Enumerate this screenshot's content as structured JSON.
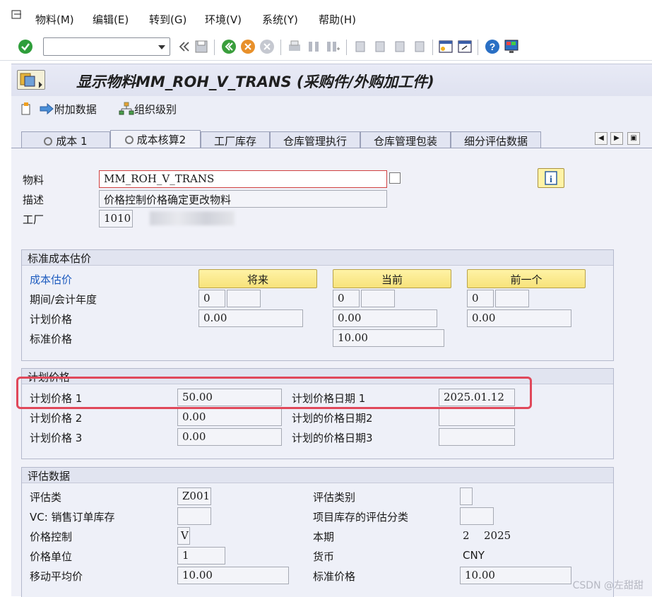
{
  "menu": {
    "items": [
      "物料(M)",
      "编辑(E)",
      "转到(G)",
      "环境(V)",
      "系统(Y)",
      "帮助(H)"
    ]
  },
  "toolbar": {
    "command_value": "",
    "icons": [
      "enter-icon",
      "back-arrows-icon",
      "save-icon",
      "back-icon",
      "exit-icon",
      "cancel-icon",
      "print-icon",
      "find-icon",
      "find-next-icon",
      "first-page-icon",
      "prev-page-icon",
      "next-page-icon",
      "last-page-icon",
      "new-session-icon",
      "shortcut-icon",
      "help-icon",
      "customize-layout-icon"
    ]
  },
  "title": "显示物料MM_ROH_V_TRANS (采购件/外购加工件)",
  "app_toolbar": {
    "additional_data": "附加数据",
    "org_levels": "组织级别"
  },
  "tabs": [
    "成本 1",
    "成本核算2",
    "工厂库存",
    "仓库管理执行",
    "仓库管理包装",
    "细分评估数据"
  ],
  "active_tab": 1,
  "header": {
    "material_label": "物料",
    "material_value": "MM_ROH_V_TRANS",
    "description_label": "描述",
    "description_value": "价格控制价格确定更改物料",
    "plant_label": "工厂",
    "plant_value": "1010"
  },
  "std_cost": {
    "title": "标准成本估价",
    "cost_estimate_label": "成本估价",
    "future_btn": "将来",
    "current_btn": "当前",
    "previous_btn": "前一个",
    "period_label": "期间/会计年度",
    "future_period": "0",
    "current_period": "0",
    "previous_period": "0",
    "planned_price_label": "计划价格",
    "future_planned": "0.00",
    "current_planned": "0.00",
    "previous_planned": "0.00",
    "std_price_label": "标准价格",
    "current_std": "10.00"
  },
  "planned_prices": {
    "title": "计划价格",
    "price1_label": "计划价格 1",
    "price1_value": "50.00",
    "date1_label": "计划价格日期 1",
    "date1_value": "2025.01.12",
    "price2_label": "计划价格 2",
    "price2_value": "0.00",
    "date2_label": "计划的价格日期2",
    "price3_label": "计划价格 3",
    "price3_value": "0.00",
    "date3_label": "计划的价格日期3"
  },
  "valuation": {
    "title": "评估数据",
    "val_class_label": "评估类",
    "val_class_value": "Z001",
    "val_category_label": "评估类别",
    "vc_label": "VC: 销售订单库存",
    "proj_stock_label": "项目库存的评估分类",
    "price_control_label": "价格控制",
    "price_control_value": "V",
    "current_period_label": "本期",
    "current_period_value": "2",
    "current_year_value": "2025",
    "price_unit_label": "价格单位",
    "price_unit_value": "1",
    "currency_label": "货币",
    "currency_value": "CNY",
    "map_label": "移动平均价",
    "map_value": "10.00",
    "std_price_label": "标准价格",
    "std_price_value": "10.00"
  },
  "watermark": "CSDN @左甜甜",
  "colors": {
    "highlight": "#e0485a",
    "button_yellow": "#f7e27a",
    "link_blue": "#1d5bbf"
  }
}
